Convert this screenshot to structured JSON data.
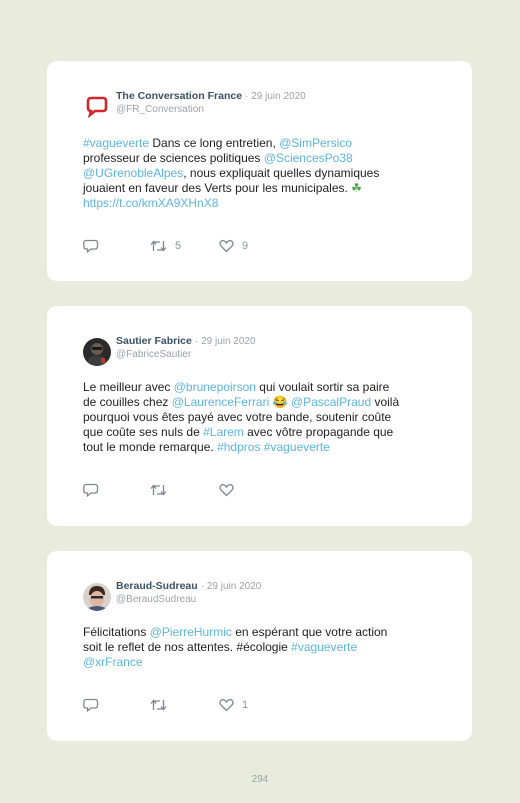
{
  "tweets": [
    {
      "display_name": "The Conversation France",
      "date": "29 juin 2020",
      "handle": "@FR_Conversation",
      "avatar_icon": "speech-bubble-logo-icon",
      "segments": [
        {
          "text": "#vagueverte",
          "link": true
        },
        {
          "text": " Dans ce long entretien, ",
          "link": false
        },
        {
          "text": "@SimPersico",
          "link": true
        },
        {
          "text": "\nprofesseur de sciences politiques ",
          "link": false
        },
        {
          "text": "@SciencesPo38",
          "link": true
        },
        {
          "text": "\n",
          "link": false
        },
        {
          "text": "@UGrenobleAlpes",
          "link": true
        },
        {
          "text": ", nous expliquait quelles dynamiques\njouaient en faveur des Verts pour les municipales. ",
          "link": false
        },
        {
          "text": "☘",
          "emoji": true
        },
        {
          "text": "\n",
          "link": false
        },
        {
          "text": "https://t.co/kmXA9XHnX8",
          "link": true
        }
      ],
      "reply_count": "",
      "retweet_count": "5",
      "like_count": "9"
    },
    {
      "display_name": "Sautier Fabrice",
      "date": "29 juin 2020",
      "handle": "@FabriceSautier",
      "avatar_icon": "profile-photo-icon",
      "segments": [
        {
          "text": "Le meilleur avec ",
          "link": false
        },
        {
          "text": "@brunepoirson",
          "link": true
        },
        {
          "text": " qui voulait sortir sa paire\nde couilles chez ",
          "link": false
        },
        {
          "text": "@LaurenceFerrari",
          "link": true
        },
        {
          "text": " 😂 ",
          "link": false
        },
        {
          "text": "@PascalPraud",
          "link": true
        },
        {
          "text": " voilà\npourquoi vous êtes payé avec votre bande, soutenir coûte\nque coûte ses nuls de ",
          "link": false
        },
        {
          "text": "#Larem",
          "link": true
        },
        {
          "text": " avec vôtre propagande que\ntout le monde remarque. ",
          "link": false
        },
        {
          "text": "#hdpros",
          "link": true
        },
        {
          "text": " ",
          "link": false
        },
        {
          "text": "#vagueverte",
          "link": true
        }
      ],
      "reply_count": "",
      "retweet_count": "",
      "like_count": ""
    },
    {
      "display_name": "Beraud-Sudreau",
      "date": "29 juin 2020",
      "handle": "@BeraudSudreau",
      "avatar_icon": "profile-photo-icon",
      "segments": [
        {
          "text": "Félicitations ",
          "link": false
        },
        {
          "text": "@PierreHurmic",
          "link": true
        },
        {
          "text": " en espérant que votre action\nsoit le reflet de nos attentes. #écologie ",
          "link": false
        },
        {
          "text": "#vagueverte",
          "link": true
        },
        {
          "text": "\n",
          "link": false
        },
        {
          "text": "@xrFrance",
          "link": true
        }
      ],
      "reply_count": "",
      "retweet_count": "",
      "like_count": "1"
    }
  ],
  "separator": "·",
  "page_number": "294",
  "colors": {
    "background": "#e9ecdc",
    "link": "#5bb5e3",
    "name": "#3b5166",
    "muted": "#9aa3ab"
  }
}
